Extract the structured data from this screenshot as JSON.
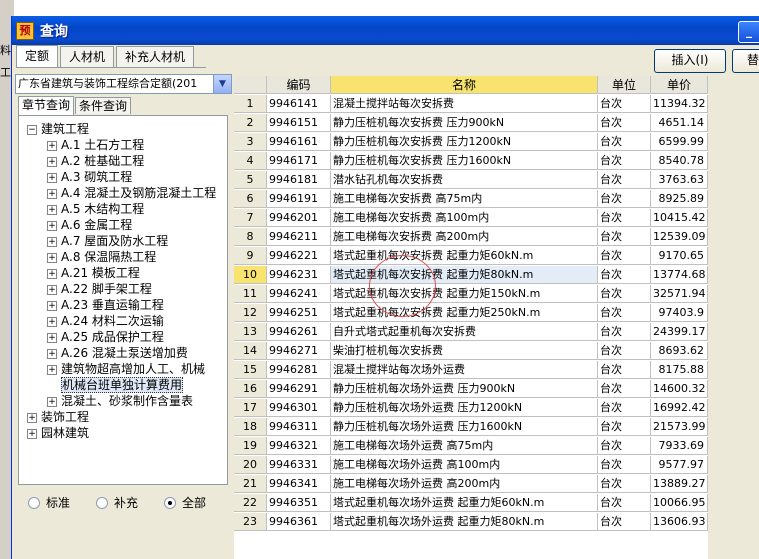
{
  "background_fragments": [
    "料",
    "工"
  ],
  "window": {
    "title": "查询",
    "close_glyph": "_"
  },
  "tabs": [
    "定额",
    "人材机",
    "补充人材机"
  ],
  "buttons": {
    "insert": "插入(I)",
    "replace": "替"
  },
  "combo": {
    "value": "广东省建筑与装饰工程综合定额(201"
  },
  "subtabs": [
    "章节查询",
    "条件查询"
  ],
  "tree": [
    {
      "label": "建筑工程",
      "level": 0,
      "expander": "minus"
    },
    {
      "label": "A.1 土石方工程",
      "level": 1,
      "expander": "plus"
    },
    {
      "label": "A.2 桩基础工程",
      "level": 1,
      "expander": "plus"
    },
    {
      "label": "A.3 砌筑工程",
      "level": 1,
      "expander": "plus"
    },
    {
      "label": "A.4 混凝土及钢筋混凝土工程",
      "level": 1,
      "expander": "plus"
    },
    {
      "label": "A.5 木结构工程",
      "level": 1,
      "expander": "plus"
    },
    {
      "label": "A.6 金属工程",
      "level": 1,
      "expander": "plus"
    },
    {
      "label": "A.7 屋面及防水工程",
      "level": 1,
      "expander": "plus"
    },
    {
      "label": "A.8 保温隔热工程",
      "level": 1,
      "expander": "plus"
    },
    {
      "label": "A.21 模板工程",
      "level": 1,
      "expander": "plus"
    },
    {
      "label": "A.22 脚手架工程",
      "level": 1,
      "expander": "plus"
    },
    {
      "label": "A.23 垂直运输工程",
      "level": 1,
      "expander": "plus"
    },
    {
      "label": "A.24 材料二次运输",
      "level": 1,
      "expander": "plus"
    },
    {
      "label": "A.25 成品保护工程",
      "level": 1,
      "expander": "plus"
    },
    {
      "label": "A.26 混凝土泵送增加费",
      "level": 1,
      "expander": "plus"
    },
    {
      "label": "建筑物超高增加人工、机械",
      "level": 1,
      "expander": "plus"
    },
    {
      "label": "机械台班单独计算费用",
      "level": 1,
      "expander": "none",
      "selected": true
    },
    {
      "label": "混凝土、砂浆制作含量表",
      "level": 1,
      "expander": "plus"
    },
    {
      "label": "装饰工程",
      "level": 0,
      "expander": "plus"
    },
    {
      "label": "园林建筑",
      "level": 0,
      "expander": "plus"
    }
  ],
  "radios": [
    {
      "label": "标准",
      "checked": false
    },
    {
      "label": "补充",
      "checked": false
    },
    {
      "label": "全部",
      "checked": true
    }
  ],
  "table": {
    "columns": [
      "",
      "编码",
      "名称",
      "单位",
      "单价"
    ],
    "current_row": 10,
    "rows": [
      [
        "1",
        "9946141",
        "混凝土搅拌站每次安拆费",
        "台次",
        "11394.32"
      ],
      [
        "2",
        "9946151",
        "静力压桩机每次安拆费 压力900kN",
        "台次",
        "4651.14"
      ],
      [
        "3",
        "9946161",
        "静力压桩机每次安拆费 压力1200kN",
        "台次",
        "6599.99"
      ],
      [
        "4",
        "9946171",
        "静力压桩机每次安拆费 压力1600kN",
        "台次",
        "8540.78"
      ],
      [
        "5",
        "9946181",
        "潜水钻孔机每次安拆费",
        "台次",
        "3763.63"
      ],
      [
        "6",
        "9946191",
        "施工电梯每次安拆费 高75m内",
        "台次",
        "8925.89"
      ],
      [
        "7",
        "9946201",
        "施工电梯每次安拆费 高100m内",
        "台次",
        "10415.42"
      ],
      [
        "8",
        "9946211",
        "施工电梯每次安拆费 高200m内",
        "台次",
        "12539.09"
      ],
      [
        "9",
        "9946221",
        "塔式起重机每次安拆费 起重力矩60kN.m",
        "台次",
        "9170.65"
      ],
      [
        "10",
        "9946231",
        "塔式起重机每次安拆费 起重力矩80kN.m",
        "台次",
        "13774.68"
      ],
      [
        "11",
        "9946241",
        "塔式起重机每次安拆费 起重力矩150kN.m",
        "台次",
        "32571.94"
      ],
      [
        "12",
        "9946251",
        "塔式起重机每次安拆费 起重力矩250kN.m",
        "台次",
        "97403.9"
      ],
      [
        "13",
        "9946261",
        "自升式塔式起重机每次安拆费",
        "台次",
        "24399.17"
      ],
      [
        "14",
        "9946271",
        "柴油打桩机每次安拆费",
        "台次",
        "8693.62"
      ],
      [
        "15",
        "9946281",
        "混凝土搅拌站每次场外运费",
        "台次",
        "8175.88"
      ],
      [
        "16",
        "9946291",
        "静力压桩机每次场外运费 压力900kN",
        "台次",
        "14600.32"
      ],
      [
        "17",
        "9946301",
        "静力压桩机每次场外运费 压力1200kN",
        "台次",
        "16992.42"
      ],
      [
        "18",
        "9946311",
        "静力压桩机每次场外运费 压力1600kN",
        "台次",
        "21573.99"
      ],
      [
        "19",
        "9946321",
        "施工电梯每次场外运费 高75m内",
        "台次",
        "7933.69"
      ],
      [
        "20",
        "9946331",
        "施工电梯每次场外运费 高100m内",
        "台次",
        "9577.97"
      ],
      [
        "21",
        "9946341",
        "施工电梯每次场外运费 高200m内",
        "台次",
        "13889.27"
      ],
      [
        "22",
        "9946351",
        "塔式起重机每次场外运费 起重力矩60kN.m",
        "台次",
        "10066.95"
      ],
      [
        "23",
        "9946361",
        "塔式起重机每次场外运费 起重力矩80kN.m",
        "台次",
        "13606.93"
      ]
    ]
  }
}
